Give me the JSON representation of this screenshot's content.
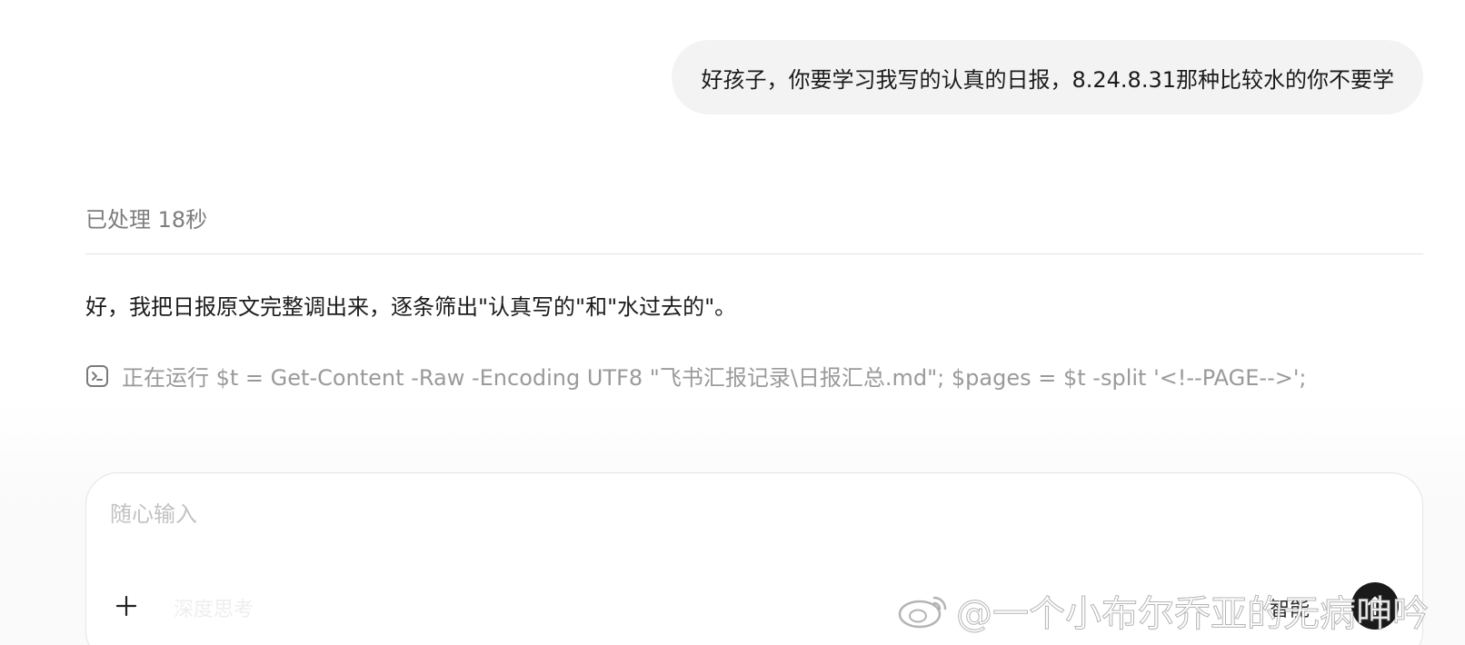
{
  "conversation": {
    "user_message": "好孩子，你要学习我写的认真的日报，8.24.8.31那种比较水的你不要学",
    "processed_label": "已处理 18秒",
    "assistant_message": "好，我把日报原文完整调出来，逐条筛出\"认真写的\"和\"水过去的\"。",
    "running_command": "正在运行 $t = Get-Content -Raw -Encoding UTF8 \"飞书汇报记录\\日报汇总.md\"; $pages = $t -split '<!--PAGE-->';",
    "running_icon": "terminal-icon"
  },
  "composer": {
    "placeholder": "随心输入",
    "plus_icon": "plus-icon",
    "mode_label": "深度思考",
    "right_label": "智能",
    "send_icon": "send-icon"
  },
  "watermark": {
    "text": "@一个小布尔乔亚的无病呻吟",
    "icon": "weibo-icon"
  }
}
